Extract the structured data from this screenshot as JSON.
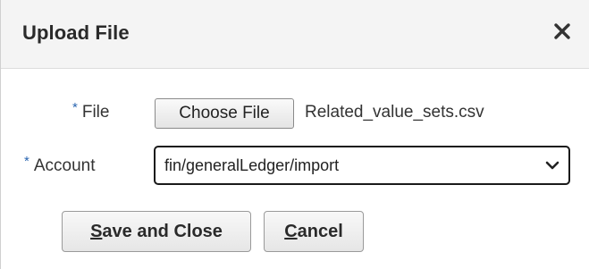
{
  "dialog": {
    "title": "Upload File",
    "close_icon": "close-icon"
  },
  "file_field": {
    "required_marker": "*",
    "label": "File",
    "button_label": "Choose File",
    "selected_filename": "Related_value_sets.csv"
  },
  "account_field": {
    "required_marker": "*",
    "label": "Account",
    "selected_value": "fin/generalLedger/import",
    "chevron_icon": "chevron-down-icon"
  },
  "actions": {
    "save_mnemonic": "S",
    "save_rest": "ave and Close",
    "cancel_mnemonic": "C",
    "cancel_rest": "ancel"
  },
  "colors": {
    "required_marker": "#2b66b1",
    "header_background": "#f4f4f4"
  }
}
